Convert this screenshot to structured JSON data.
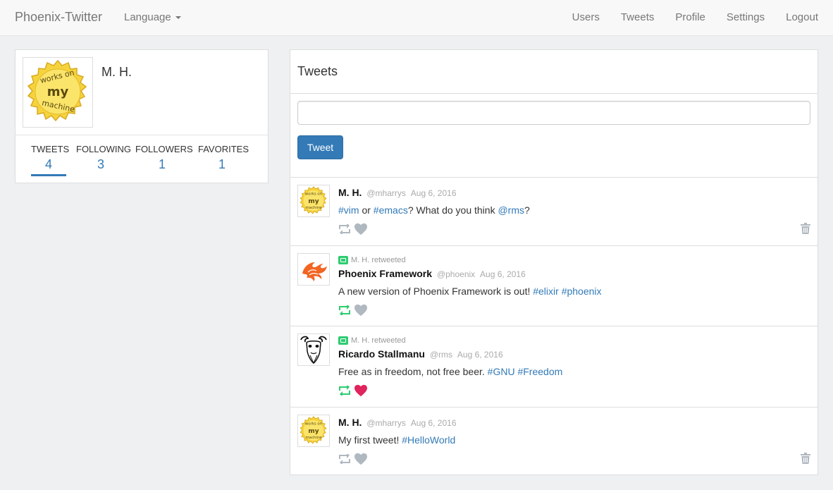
{
  "nav": {
    "brand": "Phoenix-Twitter",
    "language": "Language",
    "links": [
      "Users",
      "Tweets",
      "Profile",
      "Settings",
      "Logout"
    ]
  },
  "profile": {
    "name": "M. H.",
    "avatar": "works-on-my-machine-badge",
    "avatar_text": [
      "works on",
      "my",
      "machine"
    ],
    "stats": [
      {
        "label": "TWEETS",
        "value": "4",
        "active": true
      },
      {
        "label": "FOLLOWING",
        "value": "3",
        "active": false
      },
      {
        "label": "FOLLOWERS",
        "value": "1",
        "active": false
      },
      {
        "label": "FAVORITES",
        "value": "1",
        "active": false
      }
    ]
  },
  "tweets_panel": {
    "title": "Tweets",
    "input_value": "",
    "button": "Tweet"
  },
  "tweets": [
    {
      "retweet_by": "",
      "name": "M. H.",
      "handle": "@mharrys",
      "date": "Aug 6, 2016",
      "avatar": "works-on-my-machine-badge",
      "text_parts": [
        {
          "t": "#vim",
          "tag": true
        },
        {
          "t": " or ",
          "tag": false
        },
        {
          "t": "#emacs",
          "tag": true
        },
        {
          "t": "? What do you think ",
          "tag": false
        },
        {
          "t": "@rms",
          "tag": true
        },
        {
          "t": "?",
          "tag": false
        }
      ],
      "retweeted": false,
      "favorited": false,
      "deletable": true
    },
    {
      "retweet_by": "M. H. retweeted",
      "name": "Phoenix Framework",
      "handle": "@phoenix",
      "date": "Aug 6, 2016",
      "avatar": "phoenix-logo",
      "text_parts": [
        {
          "t": "A new version of Phoenix Framework is out! ",
          "tag": false
        },
        {
          "t": "#elixir",
          "tag": true
        },
        {
          "t": " ",
          "tag": false
        },
        {
          "t": "#phoenix",
          "tag": true
        }
      ],
      "retweeted": true,
      "favorited": false,
      "deletable": false
    },
    {
      "retweet_by": "M. H. retweeted",
      "name": "Ricardo Stallmanu",
      "handle": "@rms",
      "date": "Aug 6, 2016",
      "avatar": "gnu-head",
      "text_parts": [
        {
          "t": "Free as in freedom, not free beer. ",
          "tag": false
        },
        {
          "t": "#GNU",
          "tag": true
        },
        {
          "t": " ",
          "tag": false
        },
        {
          "t": "#Freedom",
          "tag": true
        }
      ],
      "retweeted": true,
      "favorited": true,
      "deletable": false
    },
    {
      "retweet_by": "",
      "name": "M. H.",
      "handle": "@mharrys",
      "date": "Aug 6, 2016",
      "avatar": "works-on-my-machine-badge",
      "text_parts": [
        {
          "t": "My first tweet! ",
          "tag": false
        },
        {
          "t": "#HelloWorld",
          "tag": true
        }
      ],
      "retweeted": false,
      "favorited": false,
      "deletable": true
    }
  ],
  "colors": {
    "link": "#337ab7",
    "retweet_active": "#2ecc71",
    "favorite_active": "#e0245e",
    "icon_inactive": "#b0b8c0"
  }
}
